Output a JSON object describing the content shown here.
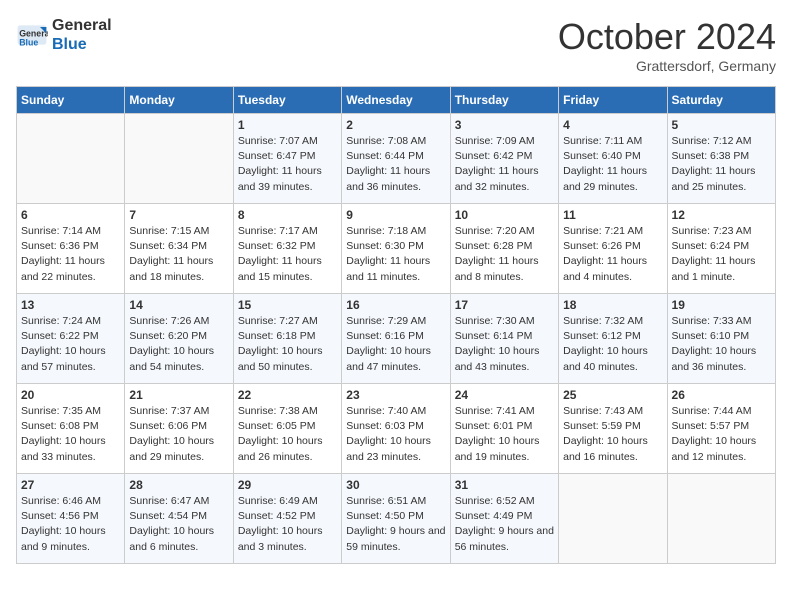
{
  "header": {
    "logo_line1": "General",
    "logo_line2": "Blue",
    "month": "October 2024",
    "location": "Grattersdorf, Germany"
  },
  "weekdays": [
    "Sunday",
    "Monday",
    "Tuesday",
    "Wednesday",
    "Thursday",
    "Friday",
    "Saturday"
  ],
  "weeks": [
    [
      {
        "day": "",
        "info": ""
      },
      {
        "day": "",
        "info": ""
      },
      {
        "day": "1",
        "info": "Sunrise: 7:07 AM\nSunset: 6:47 PM\nDaylight: 11 hours and 39 minutes."
      },
      {
        "day": "2",
        "info": "Sunrise: 7:08 AM\nSunset: 6:44 PM\nDaylight: 11 hours and 36 minutes."
      },
      {
        "day": "3",
        "info": "Sunrise: 7:09 AM\nSunset: 6:42 PM\nDaylight: 11 hours and 32 minutes."
      },
      {
        "day": "4",
        "info": "Sunrise: 7:11 AM\nSunset: 6:40 PM\nDaylight: 11 hours and 29 minutes."
      },
      {
        "day": "5",
        "info": "Sunrise: 7:12 AM\nSunset: 6:38 PM\nDaylight: 11 hours and 25 minutes."
      }
    ],
    [
      {
        "day": "6",
        "info": "Sunrise: 7:14 AM\nSunset: 6:36 PM\nDaylight: 11 hours and 22 minutes."
      },
      {
        "day": "7",
        "info": "Sunrise: 7:15 AM\nSunset: 6:34 PM\nDaylight: 11 hours and 18 minutes."
      },
      {
        "day": "8",
        "info": "Sunrise: 7:17 AM\nSunset: 6:32 PM\nDaylight: 11 hours and 15 minutes."
      },
      {
        "day": "9",
        "info": "Sunrise: 7:18 AM\nSunset: 6:30 PM\nDaylight: 11 hours and 11 minutes."
      },
      {
        "day": "10",
        "info": "Sunrise: 7:20 AM\nSunset: 6:28 PM\nDaylight: 11 hours and 8 minutes."
      },
      {
        "day": "11",
        "info": "Sunrise: 7:21 AM\nSunset: 6:26 PM\nDaylight: 11 hours and 4 minutes."
      },
      {
        "day": "12",
        "info": "Sunrise: 7:23 AM\nSunset: 6:24 PM\nDaylight: 11 hours and 1 minute."
      }
    ],
    [
      {
        "day": "13",
        "info": "Sunrise: 7:24 AM\nSunset: 6:22 PM\nDaylight: 10 hours and 57 minutes."
      },
      {
        "day": "14",
        "info": "Sunrise: 7:26 AM\nSunset: 6:20 PM\nDaylight: 10 hours and 54 minutes."
      },
      {
        "day": "15",
        "info": "Sunrise: 7:27 AM\nSunset: 6:18 PM\nDaylight: 10 hours and 50 minutes."
      },
      {
        "day": "16",
        "info": "Sunrise: 7:29 AM\nSunset: 6:16 PM\nDaylight: 10 hours and 47 minutes."
      },
      {
        "day": "17",
        "info": "Sunrise: 7:30 AM\nSunset: 6:14 PM\nDaylight: 10 hours and 43 minutes."
      },
      {
        "day": "18",
        "info": "Sunrise: 7:32 AM\nSunset: 6:12 PM\nDaylight: 10 hours and 40 minutes."
      },
      {
        "day": "19",
        "info": "Sunrise: 7:33 AM\nSunset: 6:10 PM\nDaylight: 10 hours and 36 minutes."
      }
    ],
    [
      {
        "day": "20",
        "info": "Sunrise: 7:35 AM\nSunset: 6:08 PM\nDaylight: 10 hours and 33 minutes."
      },
      {
        "day": "21",
        "info": "Sunrise: 7:37 AM\nSunset: 6:06 PM\nDaylight: 10 hours and 29 minutes."
      },
      {
        "day": "22",
        "info": "Sunrise: 7:38 AM\nSunset: 6:05 PM\nDaylight: 10 hours and 26 minutes."
      },
      {
        "day": "23",
        "info": "Sunrise: 7:40 AM\nSunset: 6:03 PM\nDaylight: 10 hours and 23 minutes."
      },
      {
        "day": "24",
        "info": "Sunrise: 7:41 AM\nSunset: 6:01 PM\nDaylight: 10 hours and 19 minutes."
      },
      {
        "day": "25",
        "info": "Sunrise: 7:43 AM\nSunset: 5:59 PM\nDaylight: 10 hours and 16 minutes."
      },
      {
        "day": "26",
        "info": "Sunrise: 7:44 AM\nSunset: 5:57 PM\nDaylight: 10 hours and 12 minutes."
      }
    ],
    [
      {
        "day": "27",
        "info": "Sunrise: 6:46 AM\nSunset: 4:56 PM\nDaylight: 10 hours and 9 minutes."
      },
      {
        "day": "28",
        "info": "Sunrise: 6:47 AM\nSunset: 4:54 PM\nDaylight: 10 hours and 6 minutes."
      },
      {
        "day": "29",
        "info": "Sunrise: 6:49 AM\nSunset: 4:52 PM\nDaylight: 10 hours and 3 minutes."
      },
      {
        "day": "30",
        "info": "Sunrise: 6:51 AM\nSunset: 4:50 PM\nDaylight: 9 hours and 59 minutes."
      },
      {
        "day": "31",
        "info": "Sunrise: 6:52 AM\nSunset: 4:49 PM\nDaylight: 9 hours and 56 minutes."
      },
      {
        "day": "",
        "info": ""
      },
      {
        "day": "",
        "info": ""
      }
    ]
  ]
}
